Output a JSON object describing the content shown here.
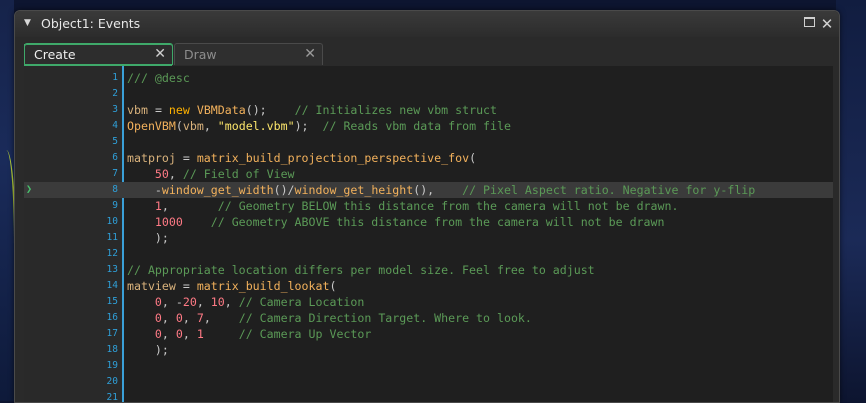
{
  "window": {
    "title": "Object1: Events",
    "collapse_glyph": "▼",
    "maximize_icon": "maximize-icon",
    "close_glyph": "✕"
  },
  "tabs": [
    {
      "label": "Create",
      "close": "✕",
      "active": true
    },
    {
      "label": "Draw",
      "close": "✕",
      "active": false
    }
  ],
  "colors": {
    "accent_green": "#3fa96a",
    "line_number_blue": "#2f9fd8",
    "comment_green": "#5b9a57",
    "number_red": "#ff7a85",
    "string_yellow": "#fce66b"
  },
  "editor": {
    "current_line": 8,
    "current_marker": "❯",
    "lines": [
      {
        "n": "1",
        "text": "/// @desc"
      },
      {
        "n": "2",
        "text": ""
      },
      {
        "n": "3",
        "text": "vbm = new VBMData();    // Initializes new vbm struct"
      },
      {
        "n": "4",
        "text": "OpenVBM(vbm, \"model.vbm\");  // Reads vbm data from file"
      },
      {
        "n": "5",
        "text": ""
      },
      {
        "n": "6",
        "text": "matproj = matrix_build_projection_perspective_fov("
      },
      {
        "n": "7",
        "text": "    50, // Field of View"
      },
      {
        "n": "8",
        "text": "    -window_get_width()/window_get_height(),    // Pixel Aspect ratio. Negative for y-flip"
      },
      {
        "n": "9",
        "text": "    1,       // Geometry BELOW this distance from the camera will not be drawn."
      },
      {
        "n": "10",
        "text": "    1000    // Geometry ABOVE this distance from the camera will not be drawn"
      },
      {
        "n": "11",
        "text": "    );"
      },
      {
        "n": "12",
        "text": ""
      },
      {
        "n": "13",
        "text": "// Appropriate location differs per model size. Feel free to adjust"
      },
      {
        "n": "14",
        "text": "matview = matrix_build_lookat("
      },
      {
        "n": "15",
        "text": "    0, -20, 10, // Camera Location"
      },
      {
        "n": "16",
        "text": "    0, 0, 7,    // Camera Direction Target. Where to look."
      },
      {
        "n": "17",
        "text": "    0, 0, 1     // Camera Up Vector"
      },
      {
        "n": "18",
        "text": "    );"
      },
      {
        "n": "19",
        "text": ""
      },
      {
        "n": "20",
        "text": ""
      },
      {
        "n": "21",
        "text": ""
      }
    ]
  }
}
